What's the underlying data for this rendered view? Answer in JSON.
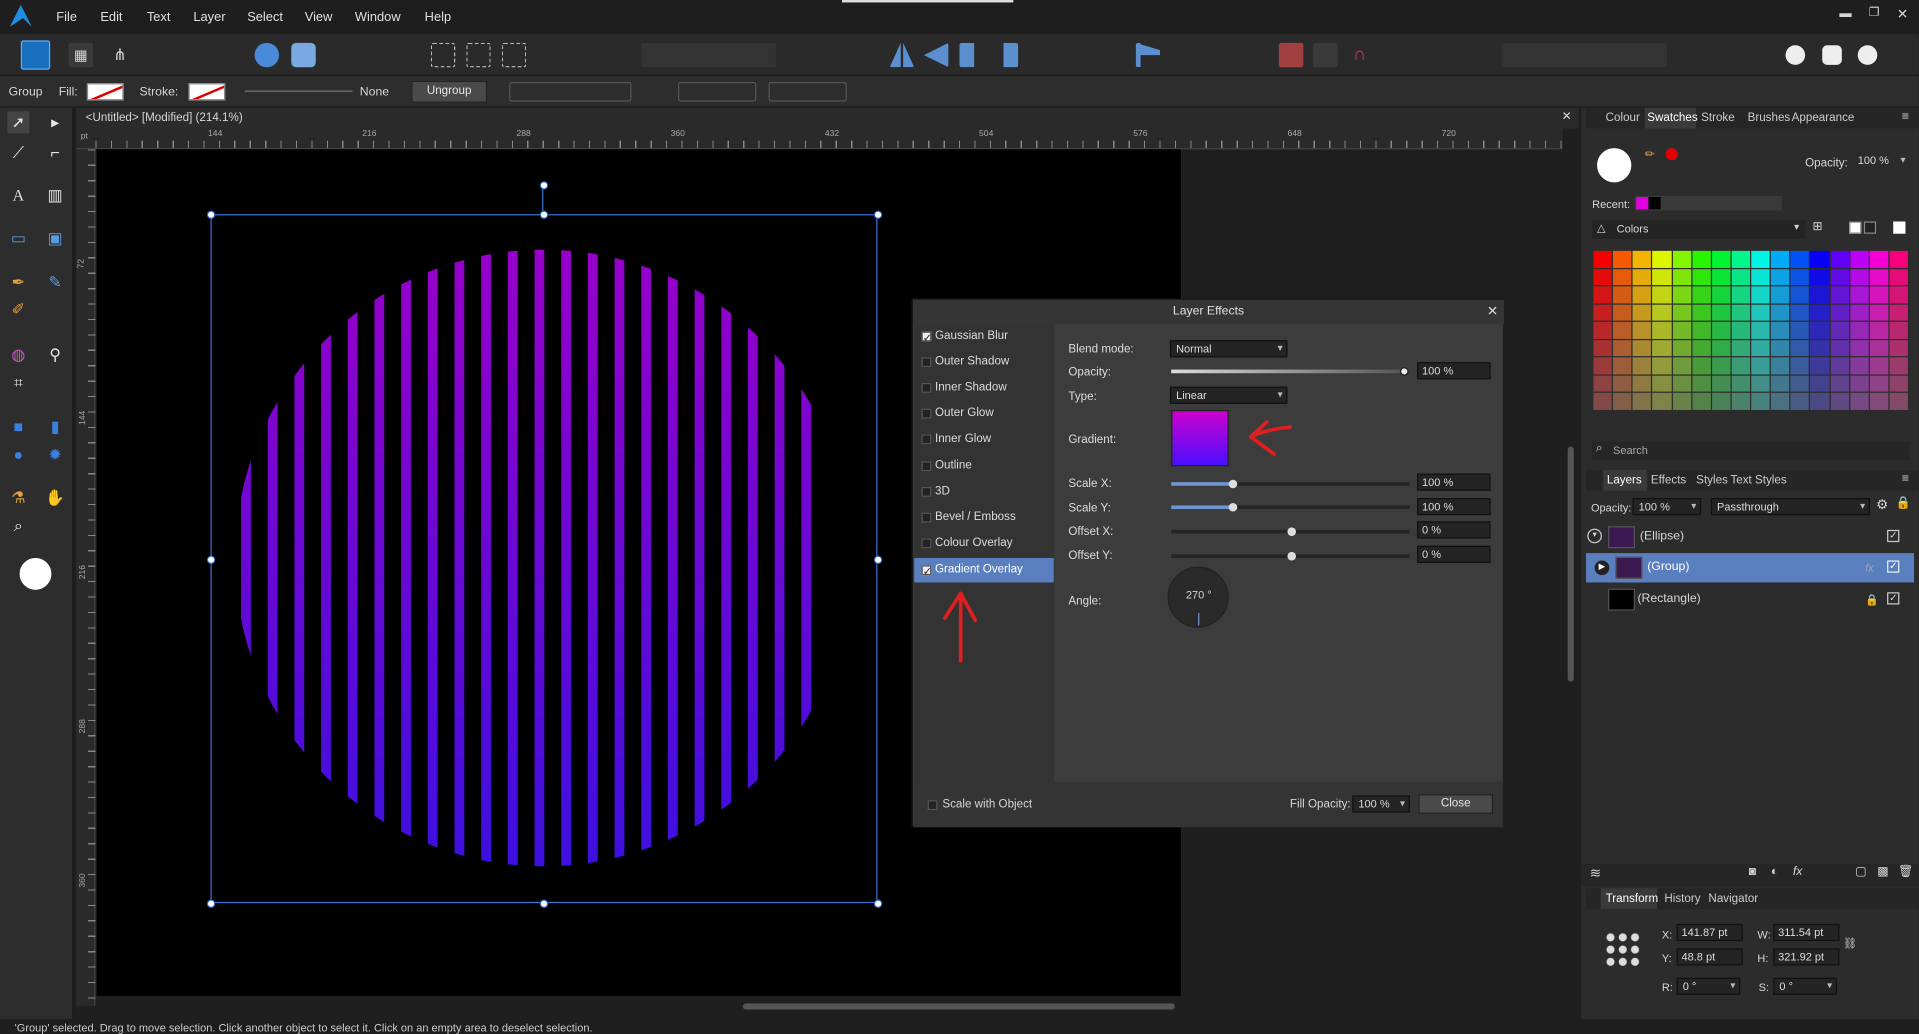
{
  "menu": {
    "items": [
      "File",
      "Edit",
      "Text",
      "Layer",
      "Select",
      "View",
      "Window",
      "Help"
    ]
  },
  "context": {
    "group_label": "Group",
    "fill_label": "Fill:",
    "stroke_label": "Stroke:",
    "stroke_none": "None",
    "ungroup": "Ungroup"
  },
  "document": {
    "tab_title": "<Untitled> [Modified] (214.1%)",
    "ruler_unit": "pt",
    "ruler_h": [
      "144",
      "216",
      "288",
      "360",
      "432",
      "504",
      "576",
      "648",
      "720"
    ],
    "ruler_v": [
      "72",
      "144",
      "216",
      "288",
      "360"
    ]
  },
  "dialog": {
    "title": "Layer Effects",
    "effects": [
      {
        "label": "Gaussian Blur",
        "checked": true
      },
      {
        "label": "Outer Shadow",
        "checked": false
      },
      {
        "label": "Inner Shadow",
        "checked": false
      },
      {
        "label": "Outer Glow",
        "checked": false
      },
      {
        "label": "Inner Glow",
        "checked": false
      },
      {
        "label": "Outline",
        "checked": false
      },
      {
        "label": "3D",
        "checked": false
      },
      {
        "label": "Bevel / Emboss",
        "checked": false
      },
      {
        "label": "Colour Overlay",
        "checked": false
      },
      {
        "label": "Gradient Overlay",
        "checked": true,
        "selected": true
      }
    ],
    "blend_label": "Blend mode:",
    "blend_value": "Normal",
    "opacity_label": "Opacity:",
    "opacity_value": "100 %",
    "type_label": "Type:",
    "type_value": "Linear",
    "gradient_label": "Gradient:",
    "gradient_colors": [
      "#cc00cc",
      "#4b10ff"
    ],
    "scalex_label": "Scale X:",
    "scalex_value": "100 %",
    "scaley_label": "Scale Y:",
    "scaley_value": "100 %",
    "offsetx_label": "Offset X:",
    "offsetx_value": "0 %",
    "offsety_label": "Offset Y:",
    "offsety_value": "0 %",
    "angle_label": "Angle:",
    "angle_value": "270 °",
    "scale_with_object": "Scale with Object",
    "fill_opacity_label": "Fill Opacity:",
    "fill_opacity_value": "100 %",
    "close": "Close"
  },
  "colour_panel": {
    "tabs": [
      "Colour",
      "Swatches",
      "Stroke",
      "Brushes",
      "Appearance"
    ],
    "active": "Swatches",
    "opacity_label": "Opacity:",
    "opacity_value": "100 %",
    "recent_label": "Recent:",
    "recent_colors": [
      "#e000e0",
      "#000000"
    ],
    "palette": "Colors",
    "search_placeholder": "Search"
  },
  "layers_panel": {
    "tabs": [
      "Layers",
      "Effects",
      "Styles",
      "Text Styles"
    ],
    "active": "Layers",
    "opacity_label": "Opacity:",
    "opacity_value": "100 %",
    "blend": "Passthrough",
    "layers": [
      {
        "name": "(Ellipse)",
        "selected": false
      },
      {
        "name": "(Group)",
        "selected": true
      },
      {
        "name": "(Rectangle)",
        "selected": false
      }
    ]
  },
  "transform_panel": {
    "tabs": [
      "Transform",
      "History",
      "Navigator"
    ],
    "active": "Transform",
    "x_label": "X:",
    "x_value": "141.87 pt",
    "y_label": "Y:",
    "y_value": "48.8 pt",
    "w_label": "W:",
    "w_value": "311.54 pt",
    "h_label": "H:",
    "h_value": "321.92 pt",
    "r_label": "R:",
    "r_value": "0 °",
    "s_label": "S:",
    "s_value": "0 °"
  },
  "status": {
    "text": "'Group' selected. Drag to move selection. Click another object to select it. Click on an empty area to deselect selection."
  },
  "colors": {
    "accent": "#5a7fbf",
    "selection": "#2c5fbf",
    "stripe_top": "#9b00c8",
    "stripe_bottom": "#3a10e0",
    "annotation": "#e02020"
  }
}
